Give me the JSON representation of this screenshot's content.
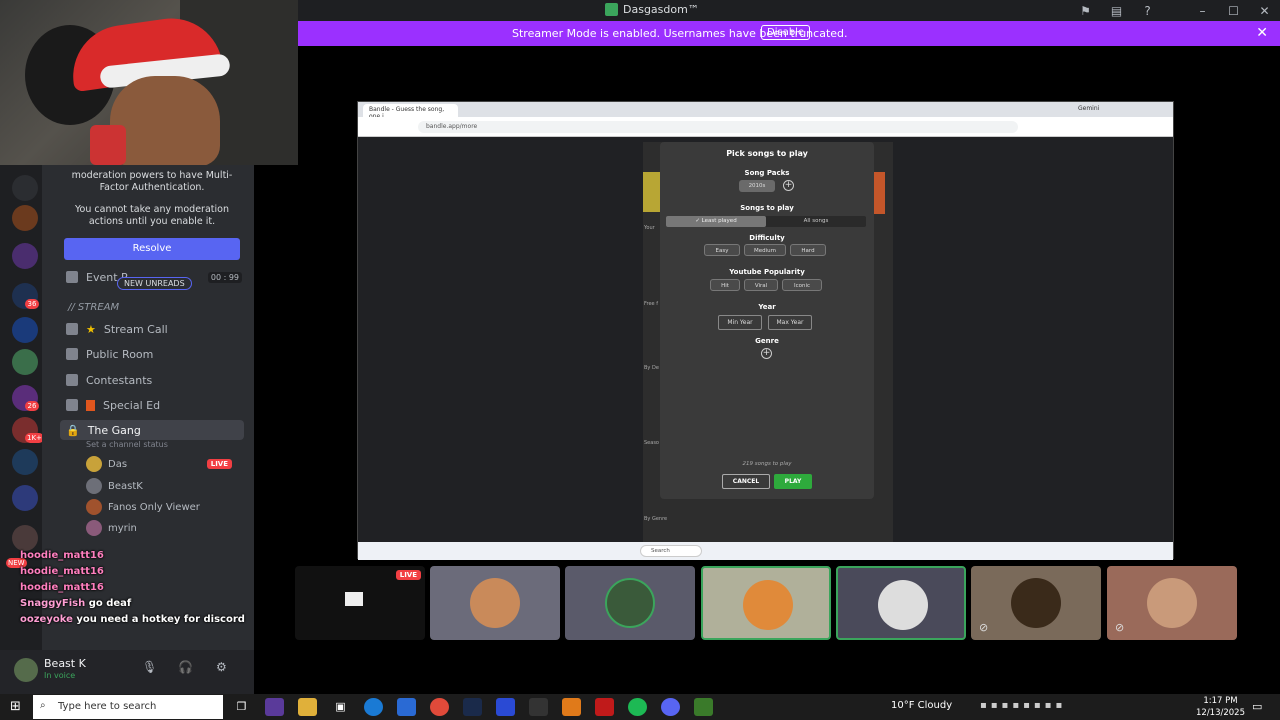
{
  "window": {
    "title": "Dasgasdom™"
  },
  "banner": {
    "message": "Streamer Mode is enabled. Usernames have been truncated.",
    "disable_label": "Disable"
  },
  "sidebar": {
    "mfa_notice": "moderation powers to have Multi-Factor Authentication.",
    "mfa_notice_2": "You cannot take any moderation actions until you enable it.",
    "resolve_label": "Resolve",
    "event_label": "Event R",
    "event_count": "00 : 99",
    "new_unreads": "NEW UNREADS",
    "category": "// STREAM",
    "channels": [
      {
        "name": "Stream Call"
      },
      {
        "name": "Public Room"
      },
      {
        "name": "Contestants"
      },
      {
        "name": "Special Ed"
      },
      {
        "name": "The Gang"
      }
    ],
    "channel_status_hint": "Set a channel status",
    "voice_users": [
      {
        "name": "Das",
        "live": "LIVE"
      },
      {
        "name": "BeastK"
      },
      {
        "name": "Fanos Only Viewer"
      },
      {
        "name": "myrin"
      }
    ],
    "server_badges": [
      "36",
      "26",
      "1K+",
      "NEW"
    ]
  },
  "overlay_chat": [
    {
      "user": "hoodie_matt16",
      "text": ""
    },
    {
      "user": "hoodie_matt16",
      "text": ""
    },
    {
      "user": "hoodie_matt16",
      "text": ""
    },
    {
      "user": "SnaggyFish",
      "text": "go deaf"
    },
    {
      "user": "oozeyoke",
      "text": "you need a hotkey for discord"
    }
  ],
  "user_panel": {
    "name": "Beast K",
    "status": "In voice"
  },
  "shared_screen": {
    "tab_title": "Bandle - Guess the song, one i",
    "url": "bandle.app/more",
    "modal": {
      "title": "Pick songs to play",
      "song_packs_label": "Song Packs",
      "pack_chip": "2010s",
      "songs_to_play_label": "Songs to play",
      "least_played": "✓ Least played",
      "all_songs": "All songs",
      "difficulty_label": "Difficulty",
      "difficulty": [
        "Easy",
        "Medium",
        "Hard"
      ],
      "popularity_label": "Youtube Popularity",
      "popularity": [
        "Hit",
        "Viral",
        "Iconic"
      ],
      "year_label": "Year",
      "min_year": "Min Year",
      "max_year": "Max Year",
      "genre_label": "Genre",
      "count_text": "219 songs to play",
      "cancel": "CANCEL",
      "play": "PLAY"
    },
    "side_labels": [
      "Your",
      "Free f",
      "By De",
      "Seaso",
      "By Genre"
    ],
    "search_placeholder": "Search",
    "gemini": "Gemini"
  },
  "tiles": [
    {
      "live": "LIVE"
    },
    {},
    {},
    {},
    {},
    {},
    {}
  ],
  "taskbar": {
    "search_placeholder": "Type here to search",
    "weather": "10°F  Cloudy",
    "time": "1:17 PM",
    "date": "12/13/2025"
  },
  "colors": {
    "banner": "#9b30ff",
    "resolve": "#5865f2",
    "live": "#f23f43",
    "play": "#2eaa3c"
  }
}
